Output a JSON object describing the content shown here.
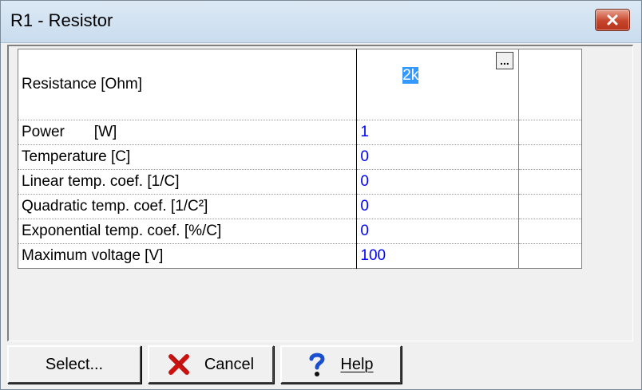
{
  "window": {
    "title": "R1 - Resistor",
    "close_icon": "close-icon"
  },
  "properties": [
    {
      "name": "Resistance [Ohm]",
      "value": "2k"
    },
    {
      "name": "Power       [W]",
      "value": "1"
    },
    {
      "name": "Temperature [C]",
      "value": "0"
    },
    {
      "name": "Linear temp. coef. [1/C]",
      "value": "0"
    },
    {
      "name": "Quadratic temp. coef. [1/C²]",
      "value": "0"
    },
    {
      "name": "Exponential temp. coef. [%/C]",
      "value": "0"
    },
    {
      "name": "Maximum voltage [V]",
      "value": "100"
    }
  ],
  "editor": {
    "browse_label": "..."
  },
  "buttons": {
    "select": "Select...",
    "cancel": "Cancel",
    "help": "Help"
  },
  "colors": {
    "value_text": "#0000ff",
    "selection": "#3399ff",
    "cancel_x": "#cc1111",
    "help_mark": "#1a4fcf"
  }
}
